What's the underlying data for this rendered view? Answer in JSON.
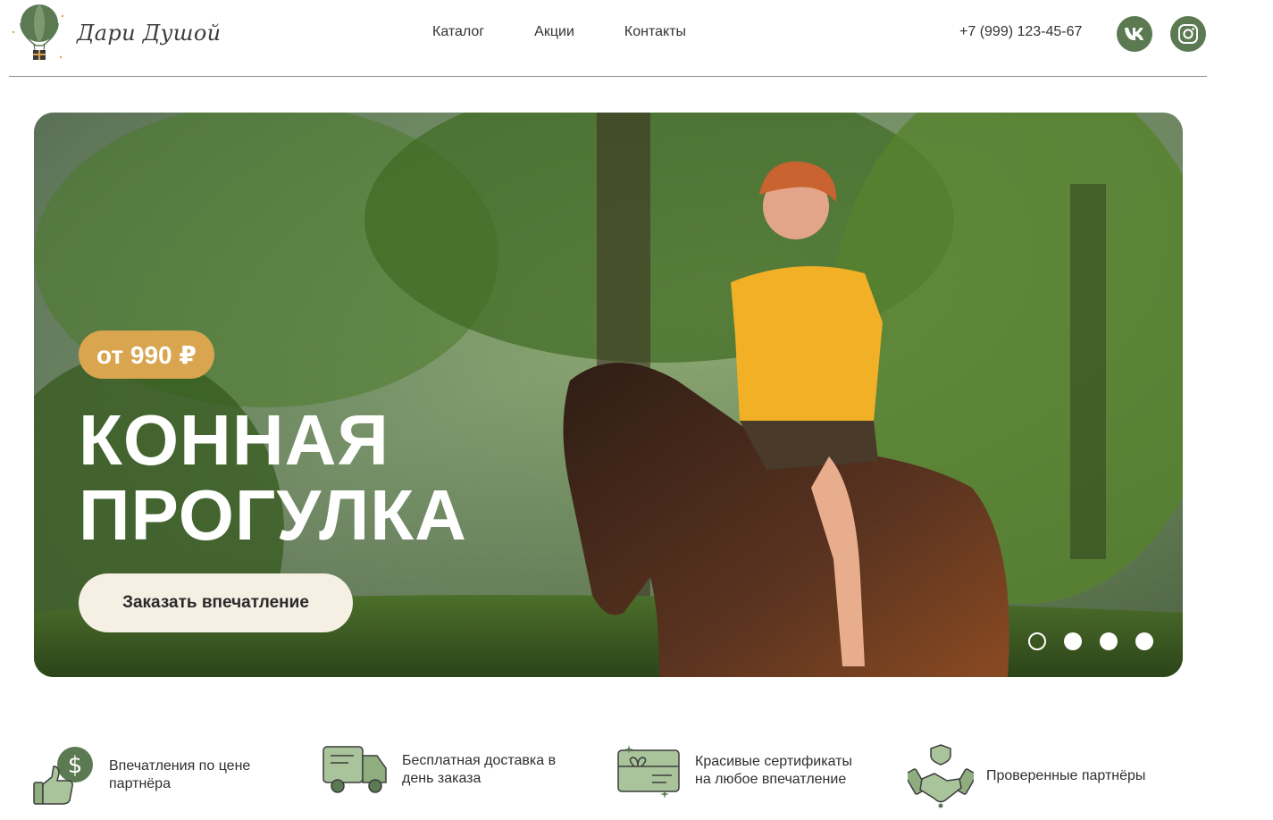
{
  "brand": {
    "name": "Дари Душой",
    "accent": "#5b7a52",
    "price_color": "#d9a54f"
  },
  "nav": {
    "items": [
      "Каталог",
      "Акции",
      "Контакты"
    ]
  },
  "contacts": {
    "phone": "+7 (999) 123-45-67",
    "social": [
      "vk-icon",
      "instagram-icon"
    ]
  },
  "hero": {
    "price": "от 990 ₽",
    "title_line1": "КОННАЯ",
    "title_line2": "ПРОГУЛКА",
    "cta_label": "Заказать впечатление",
    "slides_count": 4,
    "active_slide": 1
  },
  "features": [
    {
      "icon": "money-thumbs-up-icon",
      "line1": "Впечатления по цене",
      "line2": "партнёра"
    },
    {
      "icon": "delivery-truck-icon",
      "line1": "Бесплатная доставка в",
      "line2": "день заказа"
    },
    {
      "icon": "gift-certificate-icon",
      "line1": "Красивые сертификаты",
      "line2": "на любое впечатление"
    },
    {
      "icon": "handshake-shield-icon",
      "line1": "Проверенные партнёры",
      "line2": ""
    }
  ]
}
